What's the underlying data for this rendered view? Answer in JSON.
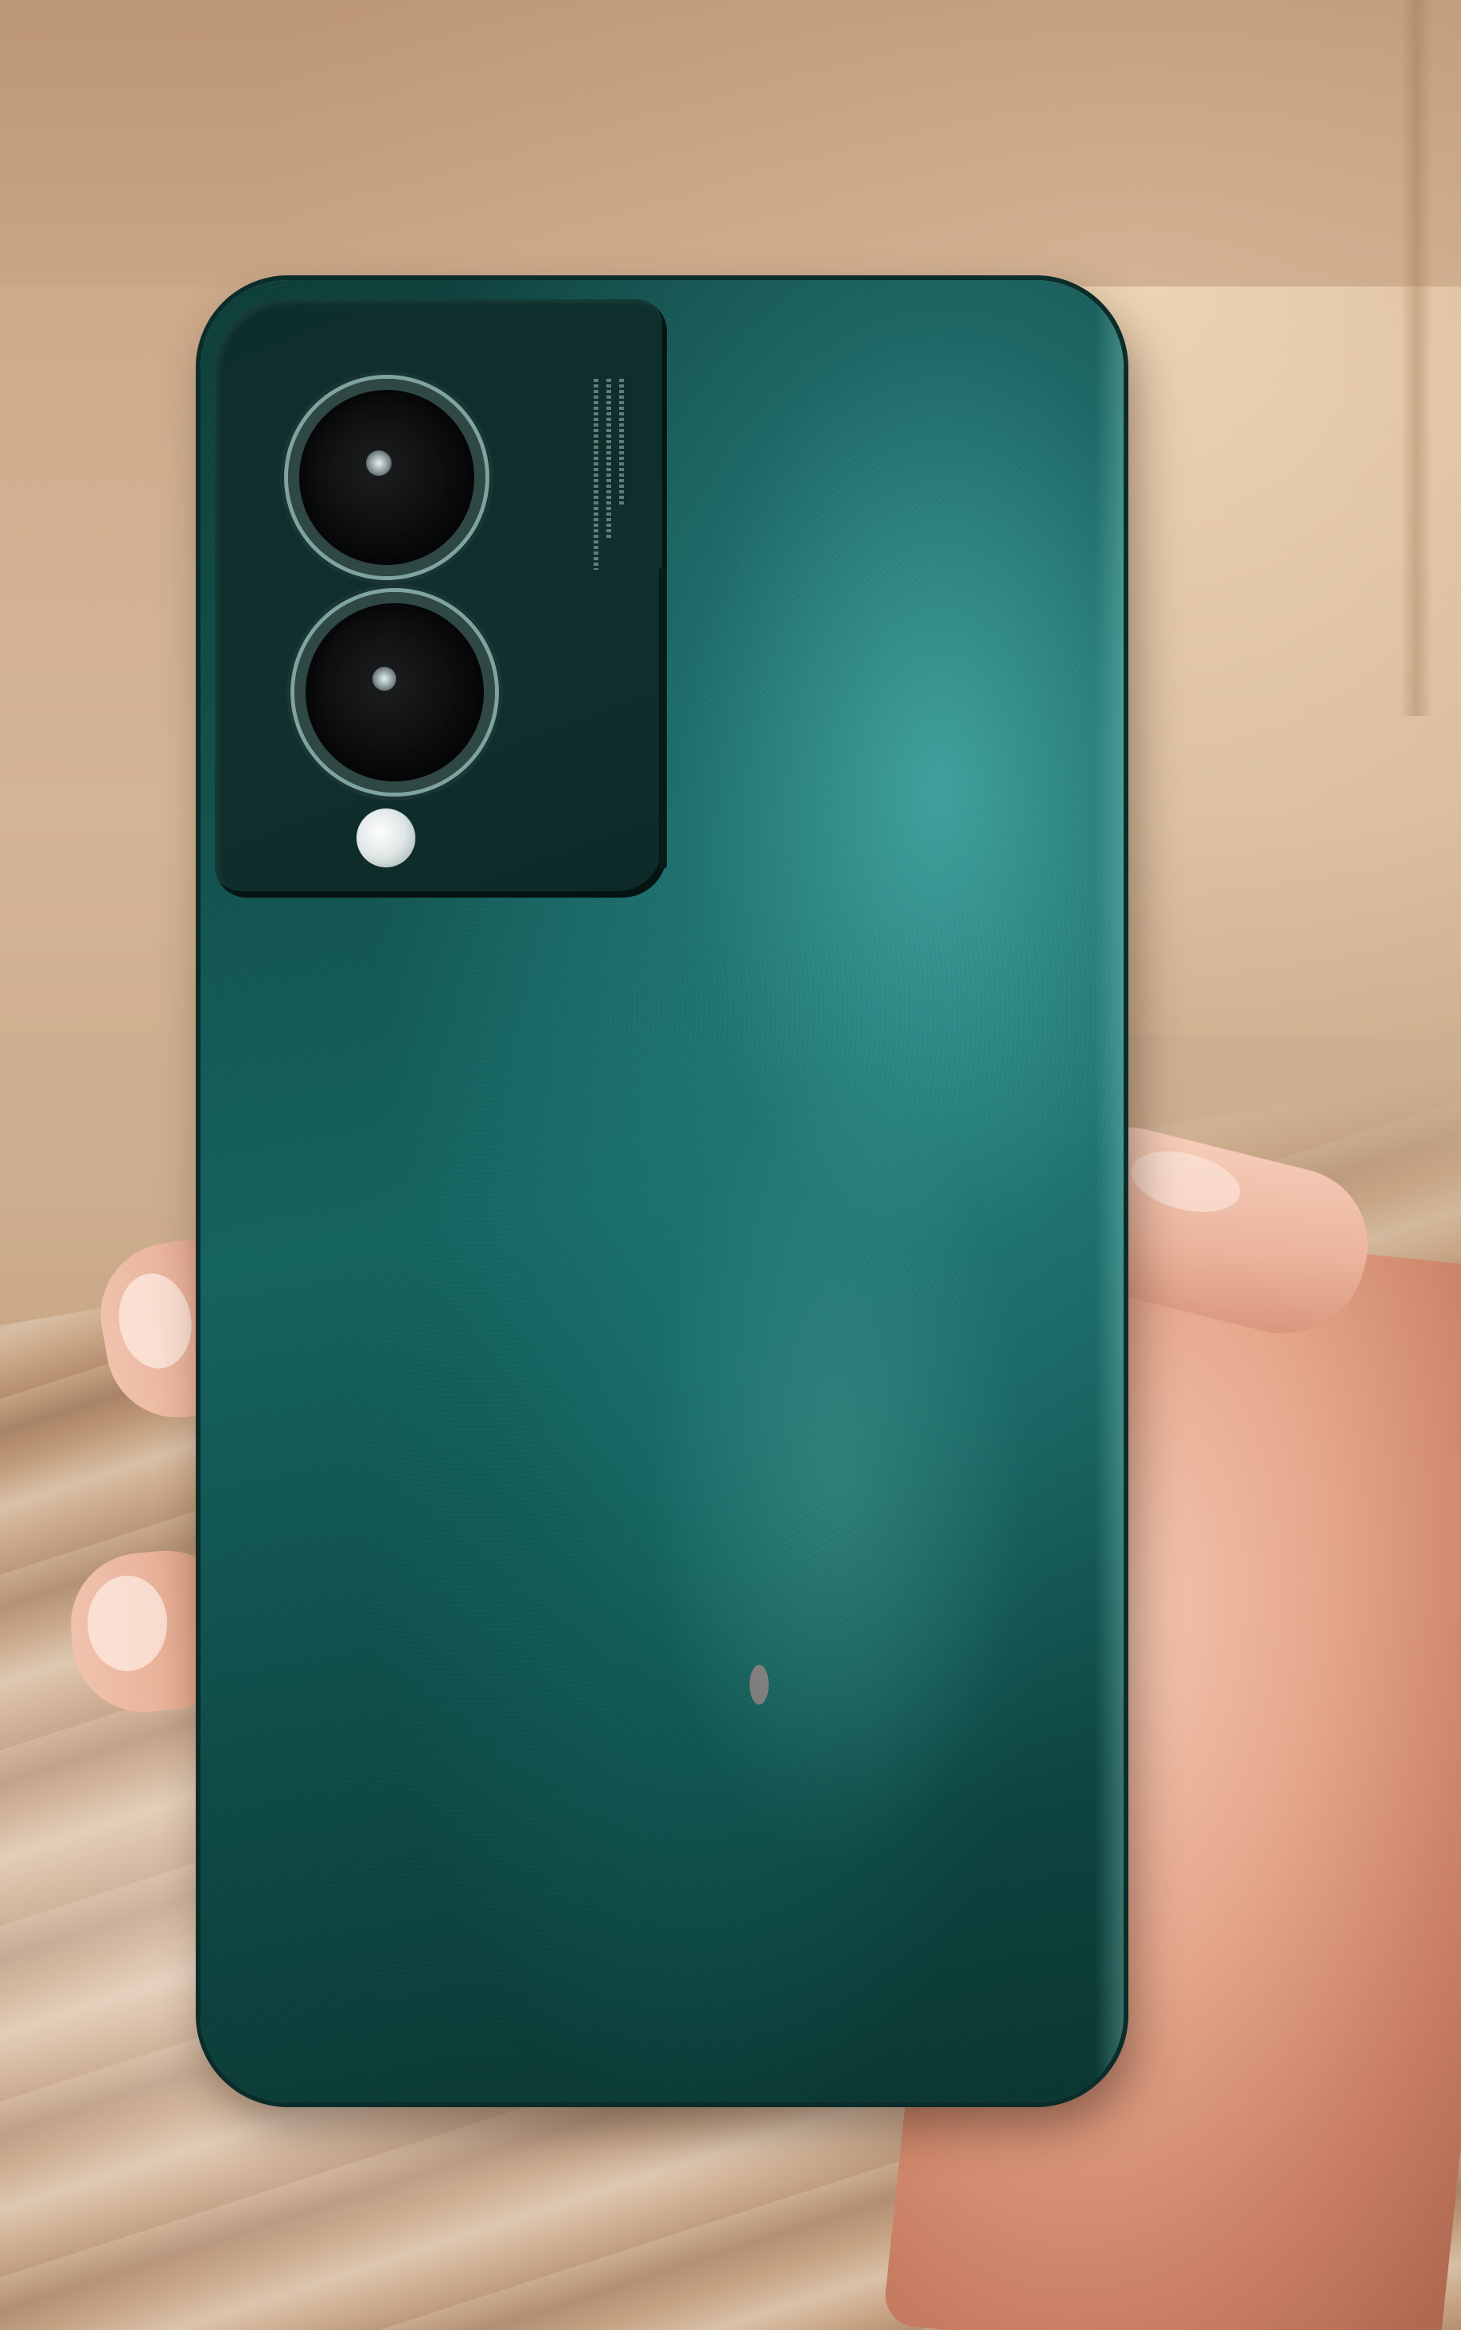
{
  "scene": {
    "subject": "phone-back",
    "colors": {
      "phone_body": "#135450",
      "phone_highlight": "#46aaa5",
      "camera_module": "#102f2d",
      "lens_ring": "#7fa4a0",
      "flash": "#dfe6e6",
      "wall": "#cfae8e",
      "floor": "#c4a282",
      "skin": "#e6a88d"
    },
    "icons": [
      "camera-lens-icon",
      "flash-icon"
    ]
  }
}
